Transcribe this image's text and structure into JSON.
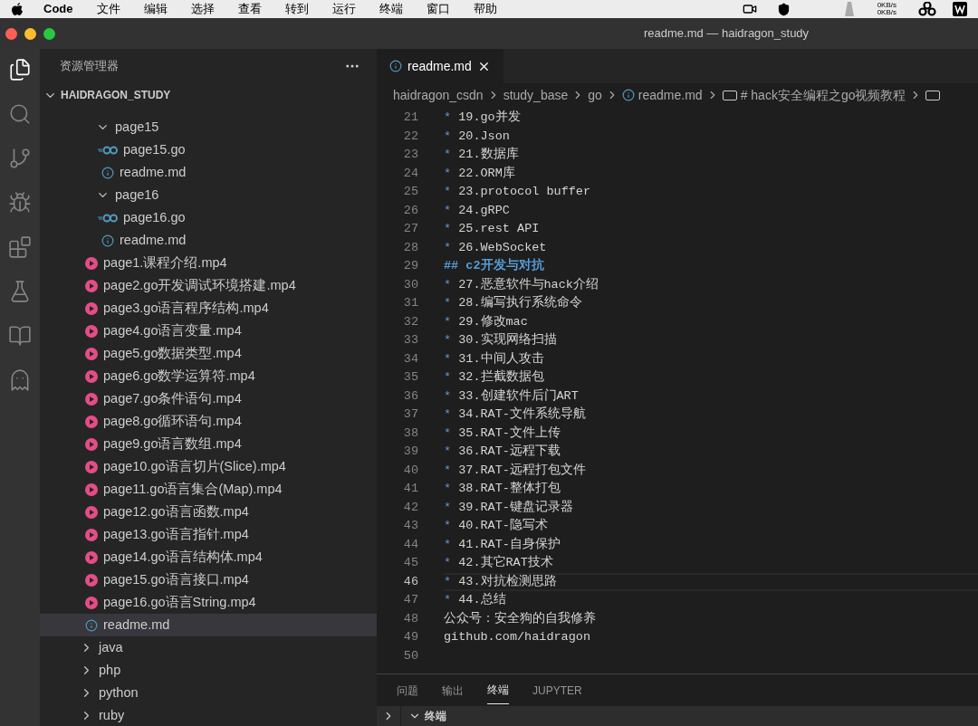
{
  "menu_bar": {
    "app": "Code",
    "items": [
      "文件",
      "编辑",
      "选择",
      "查看",
      "转到",
      "运行",
      "终端",
      "窗口",
      "帮助"
    ],
    "net": [
      "0KB/s",
      "0KB/s"
    ]
  },
  "window": {
    "title": "readme.md — haidragon_study"
  },
  "activity_bar": [
    {
      "kind": "files",
      "selected": true
    },
    {
      "kind": "search",
      "selected": false
    },
    {
      "kind": "git",
      "selected": false
    },
    {
      "kind": "debug",
      "selected": false
    },
    {
      "kind": "extensions",
      "selected": false
    },
    {
      "kind": "flask",
      "selected": false
    },
    {
      "kind": "book",
      "selected": false
    },
    {
      "kind": "alien",
      "selected": false
    }
  ],
  "sidebar": {
    "title": "资源管理器",
    "root": {
      "label": "HAIDRAGON_STUDY",
      "expanded": true,
      "children": [
        {
          "children": [
            {
              "kind": "folder",
              "label": "page15",
              "expanded": true,
              "children": [
                {
                  "kind": "go",
                  "label": "page15.go",
                  "selected": false
                },
                {
                  "kind": "md",
                  "label": "readme.md",
                  "selected": false
                }
              ]
            },
            {
              "kind": "folder",
              "label": "page16",
              "expanded": true,
              "children": [
                {
                  "kind": "go",
                  "label": "page16.go",
                  "selected": false
                },
                {
                  "kind": "md",
                  "label": "readme.md",
                  "selected": false
                }
              ]
            },
            {
              "kind": "video",
              "label": "page1.课程介绍.mp4",
              "selected": false
            },
            {
              "kind": "video",
              "label": "page2.go开发调试环境搭建.mp4",
              "selected": false
            },
            {
              "kind": "video",
              "label": "page3.go语言程序结构.mp4",
              "selected": false
            },
            {
              "kind": "video",
              "label": "page4.go语言变量.mp4",
              "selected": false
            },
            {
              "kind": "video",
              "label": "page5.go数据类型.mp4",
              "selected": false
            },
            {
              "kind": "video",
              "label": "page6.go数学运算符.mp4",
              "selected": false
            },
            {
              "kind": "video",
              "label": "page7.go条件语句.mp4",
              "selected": false
            },
            {
              "kind": "video",
              "label": "page8.go循环语句.mp4",
              "selected": false
            },
            {
              "kind": "video",
              "label": "page9.go语言数组.mp4",
              "selected": false
            },
            {
              "kind": "video",
              "label": "page10.go语言切片(Slice).mp4",
              "selected": false
            },
            {
              "kind": "video",
              "label": "page11.go语言集合(Map).mp4",
              "selected": false
            },
            {
              "kind": "video",
              "label": "page12.go语言函数.mp4",
              "selected": false
            },
            {
              "kind": "video",
              "label": "page13.go语言指针.mp4",
              "selected": false
            },
            {
              "kind": "video",
              "label": "page14.go语言结构体.mp4",
              "selected": false
            },
            {
              "kind": "video",
              "label": "page15.go语言接口.mp4",
              "selected": false
            },
            {
              "kind": "video",
              "label": "page16.go语言String.mp4",
              "selected": false
            },
            {
              "kind": "md",
              "label": "readme.md",
              "selected": true
            }
          ]
        },
        {
          "kind": "folder",
          "label": "java",
          "expanded": false
        },
        {
          "kind": "folder",
          "label": "php",
          "expanded": false
        },
        {
          "kind": "folder",
          "label": "python",
          "expanded": false
        },
        {
          "kind": "folder",
          "label": "ruby",
          "expanded": false
        }
      ]
    }
  },
  "editor": {
    "tab": {
      "label": "readme.md",
      "selected": true
    },
    "breadcrumbs": [
      {
        "kind": "folder",
        "label": "haidragon_csdn"
      },
      {
        "kind": "folder",
        "label": "study_base"
      },
      {
        "kind": "folder",
        "label": "go"
      },
      {
        "kind": "md",
        "label": "readme.md"
      },
      {
        "kind": "symbol",
        "label": "# hack安全编程之go视频教程"
      },
      {
        "kind": "symbol"
      }
    ],
    "lines": [
      {
        "number": "21",
        "kind": "bullet",
        "marker": "*",
        "text": "19.go并发",
        "current": false
      },
      {
        "number": "22",
        "kind": "bullet",
        "marker": "*",
        "text": "20.Json",
        "current": false
      },
      {
        "number": "23",
        "kind": "bullet",
        "marker": "*",
        "text": "21.数据库",
        "current": false
      },
      {
        "number": "24",
        "kind": "bullet",
        "marker": "*",
        "text": "22.ORM库",
        "current": false
      },
      {
        "number": "25",
        "kind": "bullet",
        "marker": "*",
        "text": "23.protocol buffer",
        "current": false
      },
      {
        "number": "26",
        "kind": "bullet",
        "marker": "*",
        "text": "24.gRPC",
        "current": false
      },
      {
        "number": "27",
        "kind": "bullet",
        "marker": "*",
        "text": "25.rest API",
        "current": false
      },
      {
        "number": "28",
        "kind": "bullet",
        "marker": "*",
        "text": "26.WebSocket",
        "current": false
      },
      {
        "number": "29",
        "kind": "heading",
        "text": "## c2开发与对抗",
        "current": false
      },
      {
        "number": "30",
        "kind": "bullet",
        "marker": "*",
        "text": "27.恶意软件与hack介绍",
        "current": false
      },
      {
        "number": "31",
        "kind": "bullet",
        "marker": "*",
        "text": "28.编写执行系统命令",
        "current": false
      },
      {
        "number": "32",
        "kind": "bullet",
        "marker": "*",
        "text": "29.修改mac",
        "current": false
      },
      {
        "number": "33",
        "kind": "bullet",
        "marker": "*",
        "text": "30.实现网络扫描",
        "current": false
      },
      {
        "number": "34",
        "kind": "bullet",
        "marker": "*",
        "text": "31.中间人攻击",
        "current": false
      },
      {
        "number": "35",
        "kind": "bullet",
        "marker": "*",
        "text": "32.拦截数据包",
        "current": false
      },
      {
        "number": "36",
        "kind": "bullet",
        "marker": "*",
        "text": "33.创建软件后门ART",
        "current": false
      },
      {
        "number": "37",
        "kind": "bullet",
        "marker": "*",
        "text": "34.RAT-文件系统导航",
        "current": false
      },
      {
        "number": "38",
        "kind": "bullet",
        "marker": "*",
        "text": "35.RAT-文件上传",
        "current": false
      },
      {
        "number": "39",
        "kind": "bullet",
        "marker": "*",
        "text": "36.RAT-远程下载",
        "current": false
      },
      {
        "number": "40",
        "kind": "bullet",
        "marker": "*",
        "text": "37.RAT-远程打包文件",
        "current": false
      },
      {
        "number": "41",
        "kind": "bullet",
        "marker": "*",
        "text": "38.RAT-整体打包",
        "current": false
      },
      {
        "number": "42",
        "kind": "bullet",
        "marker": "*",
        "text": "39.RAT-键盘记录器",
        "current": false
      },
      {
        "number": "43",
        "kind": "bullet",
        "marker": "*",
        "text": "40.RAT-隐写术",
        "current": false
      },
      {
        "number": "44",
        "kind": "bullet",
        "marker": "*",
        "text": "41.RAT-自身保护",
        "current": false
      },
      {
        "number": "45",
        "kind": "bullet",
        "marker": "*",
        "text": "42.其它RAT技术",
        "current": false
      },
      {
        "number": "46",
        "kind": "bullet",
        "marker": "*",
        "text": "43.对抗检测思路",
        "current": true
      },
      {
        "number": "47",
        "kind": "bullet",
        "marker": "*",
        "text": "44.总结",
        "current": false
      },
      {
        "number": "48",
        "kind": "plain",
        "text": "公众号：安全狗的自我修养",
        "current": false
      },
      {
        "number": "49",
        "kind": "plain",
        "text": "github.com/haidragon",
        "current": false
      },
      {
        "number": "50",
        "kind": "plain",
        "current": false
      }
    ]
  },
  "panel": {
    "tabs": [
      {
        "label": "问题",
        "selected": false
      },
      {
        "label": "输出",
        "selected": false
      },
      {
        "label": "终端",
        "selected": true
      },
      {
        "label": "JUPYTER",
        "selected": false
      }
    ],
    "section": {
      "label": "终端",
      "expanded": true
    }
  }
}
